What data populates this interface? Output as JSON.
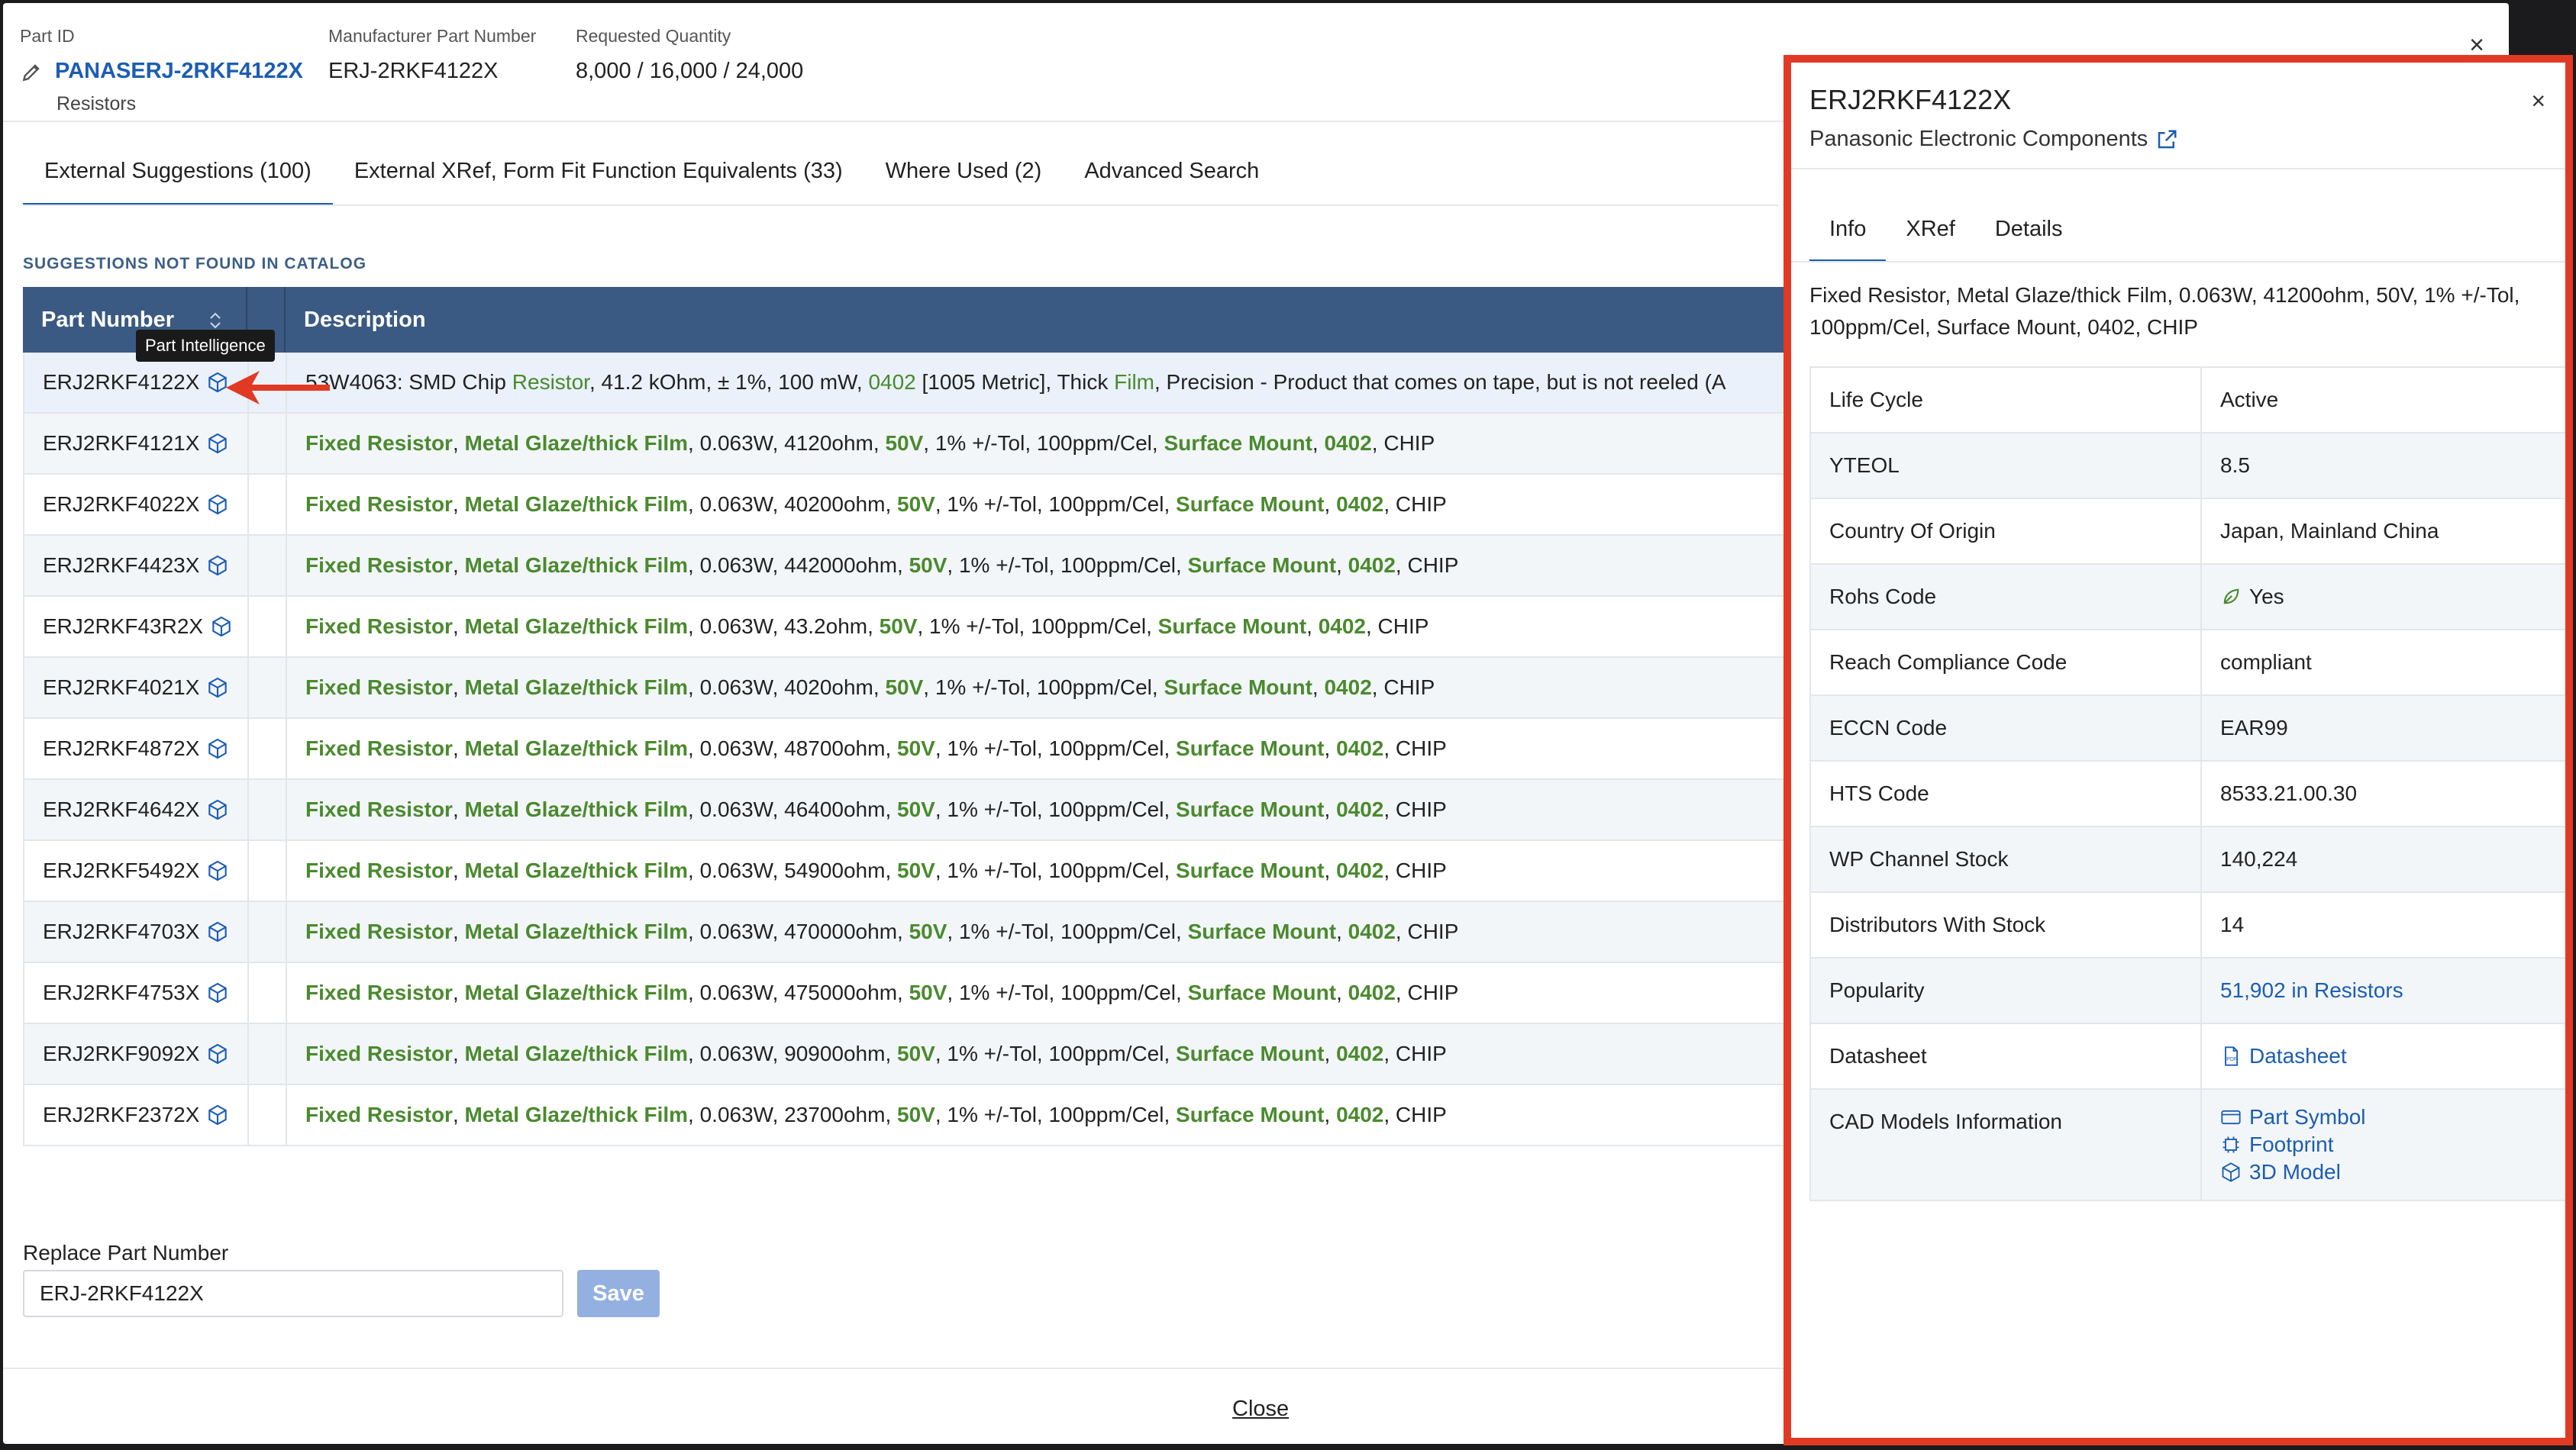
{
  "header": {
    "part_id_label": "Part ID",
    "part_id": "PANASERJ-2RKF4122X",
    "category": "Resistors",
    "mpn_label": "Manufacturer Part Number",
    "mpn": "ERJ-2RKF4122X",
    "qty_label": "Requested Quantity",
    "qty": "8,000 / 16,000 / 24,000",
    "close_icon": "×"
  },
  "tabs": [
    {
      "label": "External Suggestions (100)"
    },
    {
      "label": "External XRef, Form Fit Function Equivalents (33)"
    },
    {
      "label": "Where Used (2)"
    },
    {
      "label": "Advanced Search"
    }
  ],
  "section_title": "SUGGESTIONS NOT FOUND IN CATALOG",
  "table": {
    "col_part": "Part Number",
    "col_desc": "Description",
    "rows": [
      {
        "part": "ERJ2RKF4122X"
      },
      {
        "part": "ERJ2RKF4121X",
        "ohm": "4120ohm"
      },
      {
        "part": "ERJ2RKF4022X",
        "ohm": "40200ohm"
      },
      {
        "part": "ERJ2RKF4423X",
        "ohm": "442000ohm"
      },
      {
        "part": "ERJ2RKF43R2X",
        "ohm": "43.2ohm"
      },
      {
        "part": "ERJ2RKF4021X",
        "ohm": "4020ohm"
      },
      {
        "part": "ERJ2RKF4872X",
        "ohm": "48700ohm"
      },
      {
        "part": "ERJ2RKF4642X",
        "ohm": "46400ohm"
      },
      {
        "part": "ERJ2RKF5492X",
        "ohm": "54900ohm"
      },
      {
        "part": "ERJ2RKF4703X",
        "ohm": "470000ohm"
      },
      {
        "part": "ERJ2RKF4753X",
        "ohm": "475000ohm"
      },
      {
        "part": "ERJ2RKF9092X",
        "ohm": "90900ohm"
      },
      {
        "part": "ERJ2RKF2372X",
        "ohm": "23700ohm"
      }
    ],
    "first_desc": {
      "p1": "53W4063: SMD Chip ",
      "resistor": "Resistor",
      "p2": ", 41.2 kOhm, ± 1%, 100 mW, ",
      "size": "0402",
      "p3": " [1005 Metric], Thick ",
      "film": "Film",
      "p4": ", Precision - Product that comes on tape, but is not reeled (A"
    },
    "desc_parts": {
      "fixed": "Fixed Resistor",
      "metal": "Metal Glaze/thick Film",
      "power": "0.063W",
      "volt": "50V",
      "tol": "1% +/-Tol, 100ppm/Cel",
      "mount": "Surface Mount",
      "size": "0402",
      "chip": "CHIP",
      "comma": ", "
    }
  },
  "tooltip": "Part Intelligence",
  "replace": {
    "label": "Replace Part Number",
    "value": "ERJ-2RKF4122X",
    "save": "Save"
  },
  "footer_close": "Close",
  "panel": {
    "title": "ERJ2RKF4122X",
    "manufacturer": "Panasonic Electronic Components",
    "close_icon": "×",
    "tabs": [
      {
        "label": "Info"
      },
      {
        "label": "XRef"
      },
      {
        "label": "Details"
      }
    ],
    "description": "Fixed Resistor, Metal Glaze/thick Film, 0.063W, 41200ohm, 50V, 1% +/-Tol, 100ppm/Cel, Surface Mount, 0402, CHIP",
    "info": [
      {
        "label": "Life Cycle",
        "value": "Active"
      },
      {
        "label": "YTEOL",
        "value": "8.5"
      },
      {
        "label": "Country Of Origin",
        "value": "Japan, Mainland China"
      },
      {
        "label": "Rohs Code",
        "value": "Yes"
      },
      {
        "label": "Reach Compliance Code",
        "value": "compliant"
      },
      {
        "label": "ECCN Code",
        "value": "EAR99"
      },
      {
        "label": "HTS Code",
        "value": "8533.21.00.30"
      },
      {
        "label": "WP Channel Stock",
        "value": "140,224"
      },
      {
        "label": "Distributors With Stock",
        "value": "14"
      },
      {
        "label": "Popularity",
        "value": "51,902 in Resistors"
      },
      {
        "label": "Datasheet",
        "value": "Datasheet"
      },
      {
        "label": "CAD Models Information",
        "links": [
          "Part Symbol",
          "Footprint",
          "3D Model"
        ]
      }
    ]
  },
  "colors": {
    "primary": "#1c5db3",
    "table_header": "#3b5a83",
    "keyword_green": "#4a8a2e",
    "highlight_border": "#e13a24",
    "save_disabled": "#93b0e0"
  }
}
